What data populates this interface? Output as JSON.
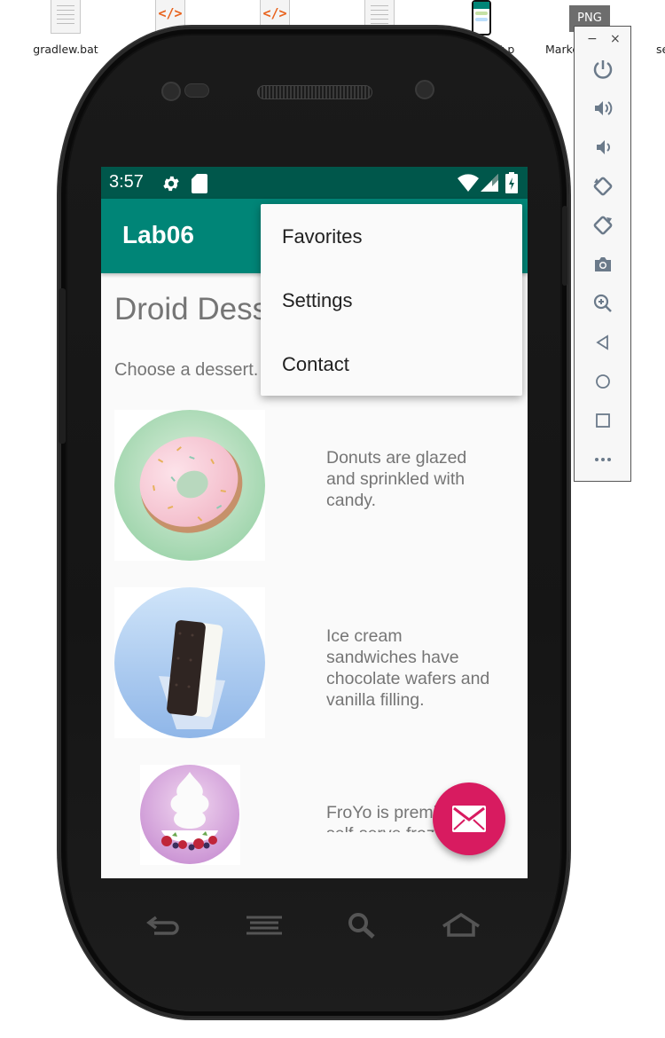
{
  "desktop": {
    "icons": [
      {
        "label": "gradlew.bat",
        "icon": "text-file-icon"
      },
      {
        "label": "",
        "icon": "code-file-icon"
      },
      {
        "label": "",
        "icon": "code-file-icon"
      },
      {
        "label": "",
        "icon": "text-file-icon"
      },
      {
        "label": "",
        "icon": "phone-screenshot-icon"
      },
      {
        "label": "Marke",
        "icon": "png-file-icon"
      },
      {
        "label": "se",
        "icon": "file-icon"
      }
    ],
    "partial_label_st": "st.p",
    "png_text": "PNG"
  },
  "status_bar": {
    "time": "3:57",
    "color": "#00574b"
  },
  "app": {
    "title": "Lab06",
    "primary_color": "#008577",
    "accent_color": "#d81b60"
  },
  "content": {
    "title": "Droid Desserts",
    "subtitle": "Choose a dessert.",
    "items": [
      {
        "image": "donut-image",
        "text": "Donuts are glazed and sprinkled with candy."
      },
      {
        "image": "ice-cream-sandwich-image",
        "text": "Ice cream sandwiches have chocolate wafers and vanilla filling."
      },
      {
        "image": "froyo-image",
        "text": "FroYo is premium self-serve frozen yogurt."
      }
    ]
  },
  "menu": {
    "items": [
      "Favorites",
      "Settings",
      "Contact"
    ]
  },
  "fab": {
    "icon": "mail-icon"
  },
  "emulator_toolbar": {
    "minimize": "−",
    "close": "×",
    "buttons": [
      "power-icon",
      "volume-up-icon",
      "volume-down-icon",
      "rotate-left-icon",
      "rotate-right-icon",
      "camera-icon",
      "zoom-icon",
      "back-icon",
      "home-icon",
      "overview-icon",
      "more-icon"
    ]
  }
}
